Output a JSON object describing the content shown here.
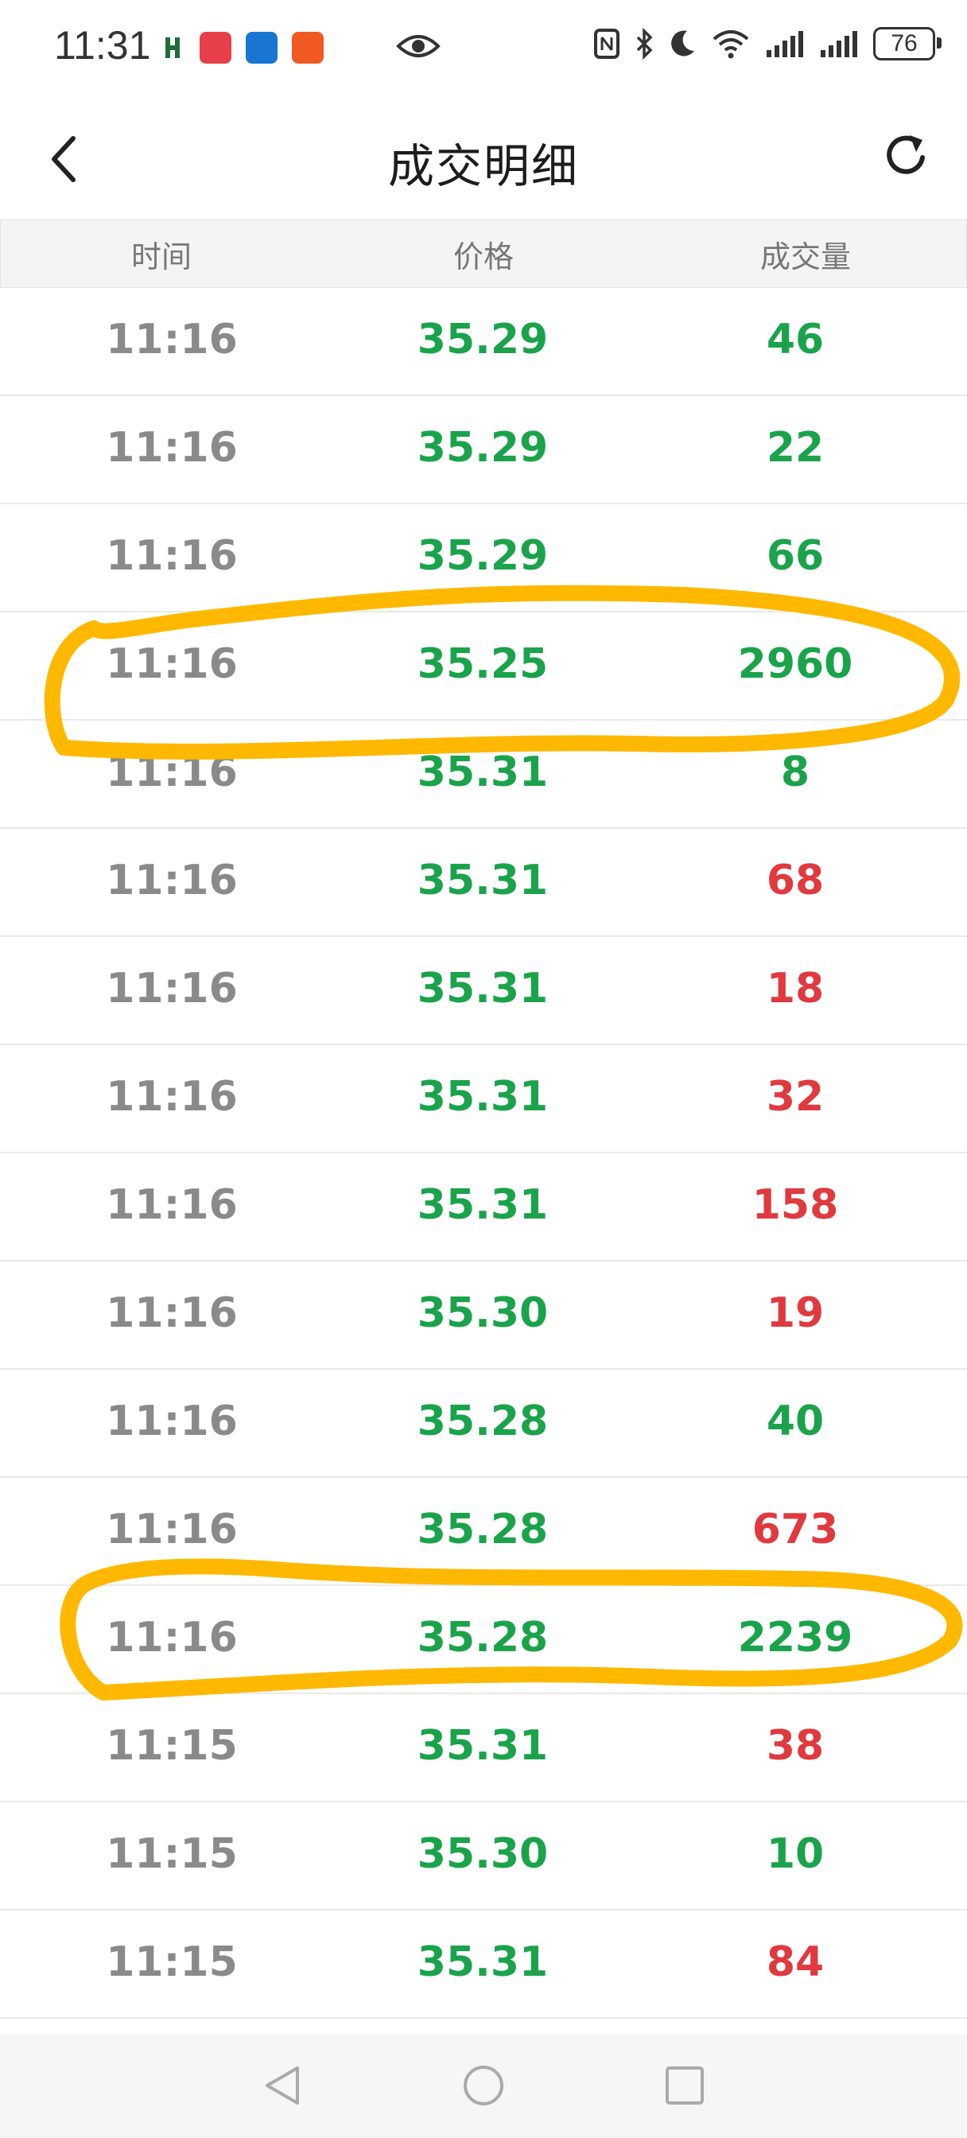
{
  "status_bar": {
    "time": "11:31",
    "battery": "76",
    "icons": [
      "app-icon",
      "huawei-app-icon",
      "blue-app-icon",
      "orange-app-icon",
      "eye-icon",
      "nfc-icon",
      "bluetooth-icon",
      "moon-icon",
      "wifi-icon",
      "signal-icon",
      "signal-icon",
      "battery-icon"
    ]
  },
  "header": {
    "title": "成交明细",
    "back_icon": "chevron-left-icon",
    "refresh_icon": "refresh-icon"
  },
  "table": {
    "columns": [
      "时间",
      "价格",
      "成交量"
    ],
    "colors": {
      "down": "#1aa34a",
      "up": "#e0393e",
      "time": "#8a8a8a"
    },
    "rows": [
      {
        "time": "11:16",
        "price": "35.29",
        "volume": "46",
        "price_color": "#1aa34a",
        "volume_color": "#1aa34a"
      },
      {
        "time": "11:16",
        "price": "35.29",
        "volume": "22",
        "price_color": "#1aa34a",
        "volume_color": "#1aa34a"
      },
      {
        "time": "11:16",
        "price": "35.29",
        "volume": "66",
        "price_color": "#1aa34a",
        "volume_color": "#1aa34a"
      },
      {
        "time": "11:16",
        "price": "35.25",
        "volume": "2960",
        "price_color": "#1aa34a",
        "volume_color": "#1aa34a"
      },
      {
        "time": "11:16",
        "price": "35.31",
        "volume": "8",
        "price_color": "#1aa34a",
        "volume_color": "#1aa34a"
      },
      {
        "time": "11:16",
        "price": "35.31",
        "volume": "68",
        "price_color": "#1aa34a",
        "volume_color": "#e0393e"
      },
      {
        "time": "11:16",
        "price": "35.31",
        "volume": "18",
        "price_color": "#1aa34a",
        "volume_color": "#e0393e"
      },
      {
        "time": "11:16",
        "price": "35.31",
        "volume": "32",
        "price_color": "#1aa34a",
        "volume_color": "#e0393e"
      },
      {
        "time": "11:16",
        "price": "35.31",
        "volume": "158",
        "price_color": "#1aa34a",
        "volume_color": "#e0393e"
      },
      {
        "time": "11:16",
        "price": "35.30",
        "volume": "19",
        "price_color": "#1aa34a",
        "volume_color": "#e0393e"
      },
      {
        "time": "11:16",
        "price": "35.28",
        "volume": "40",
        "price_color": "#1aa34a",
        "volume_color": "#1aa34a"
      },
      {
        "time": "11:16",
        "price": "35.28",
        "volume": "673",
        "price_color": "#1aa34a",
        "volume_color": "#e0393e"
      },
      {
        "time": "11:16",
        "price": "35.28",
        "volume": "2239",
        "price_color": "#1aa34a",
        "volume_color": "#1aa34a"
      },
      {
        "time": "11:15",
        "price": "35.31",
        "volume": "38",
        "price_color": "#1aa34a",
        "volume_color": "#e0393e"
      },
      {
        "time": "11:15",
        "price": "35.30",
        "volume": "10",
        "price_color": "#1aa34a",
        "volume_color": "#1aa34a"
      },
      {
        "time": "11:15",
        "price": "35.31",
        "volume": "84",
        "price_color": "#1aa34a",
        "volume_color": "#e0393e"
      }
    ]
  },
  "annotations": {
    "highlight_color": "#ffb800",
    "circled_volumes": [
      "2960",
      "2239"
    ]
  },
  "nav_bar": {
    "buttons": [
      "back-triangle-icon",
      "home-circle-icon",
      "recents-square-icon"
    ]
  }
}
